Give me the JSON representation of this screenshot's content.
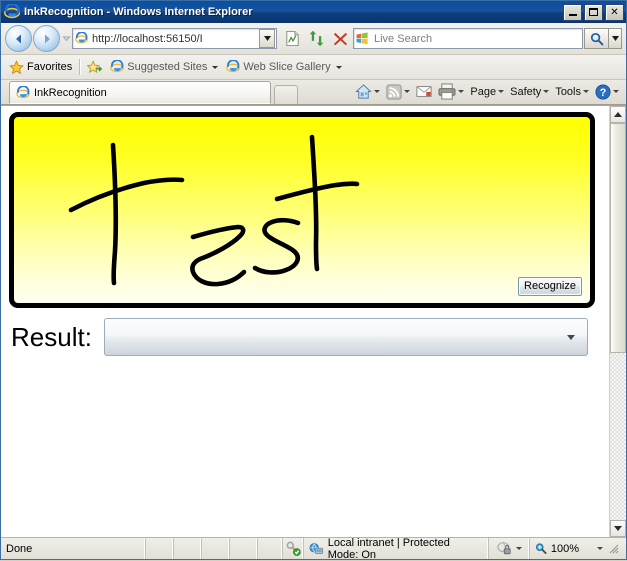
{
  "window": {
    "title": "InkRecognition - Windows Internet Explorer",
    "ie_icon": "ie-logo-icon",
    "controls": {
      "minimize": "minimize-button",
      "maximize": "maximize-button",
      "close_label": "✕"
    }
  },
  "navbar": {
    "back": "back-button",
    "forward": "forward-button",
    "history_dropdown": "history-dropdown-icon",
    "address": {
      "icon": "page-icon",
      "value": "http://localhost:56150/I",
      "dropdown_icon": "chevron-down-icon"
    },
    "buttons": {
      "compatibility": "compatibility-view-icon",
      "refresh": "refresh-icon",
      "stop": "stop-icon"
    },
    "search": {
      "icon": "windows-logo-icon",
      "placeholder": "Live Search",
      "go_icon": "search-icon",
      "provider_dropdown": "chevron-down-icon"
    }
  },
  "favorites_bar": {
    "favorites_label": "Favorites",
    "items": [
      {
        "label": "Suggested Sites",
        "icon": "ie-page-icon",
        "has_caret": true
      },
      {
        "label": "Web Slice Gallery",
        "icon": "ie-page-icon",
        "has_caret": true
      }
    ],
    "add_favorite_icon": "add-favorite-icon"
  },
  "tabs": [
    {
      "label": "InkRecognition",
      "icon": "ie-logo-icon",
      "active": true
    }
  ],
  "new_tab_label": "",
  "command_bar": [
    {
      "name": "home",
      "label": "",
      "icon": "home-icon",
      "caret": true
    },
    {
      "name": "feeds",
      "label": "",
      "icon": "rss-icon",
      "caret": true
    },
    {
      "name": "mail",
      "label": "",
      "icon": "mail-icon",
      "caret": false
    },
    {
      "name": "print",
      "label": "",
      "icon": "printer-icon",
      "caret": true
    },
    {
      "name": "page",
      "label": "Page",
      "icon": "",
      "caret": true
    },
    {
      "name": "safety",
      "label": "Safety",
      "icon": "",
      "caret": true
    },
    {
      "name": "tools",
      "label": "Tools",
      "icon": "",
      "caret": true
    },
    {
      "name": "help",
      "label": "",
      "icon": "help-icon",
      "caret": true
    }
  ],
  "page": {
    "ink_canvas": {
      "name": "ink-canvas",
      "handwritten_text": "test",
      "gradient_top_color": "#ffff00",
      "gradient_bottom_color": "#fffff2",
      "stroke_color": "#000000",
      "border_color": "#000000",
      "recognize_button_label": "Recognize"
    },
    "result": {
      "label": "Result:",
      "combo_value": "",
      "combo_dropdown_icon": "chevron-down-icon"
    }
  },
  "scrollbar": {
    "up_icon": "scroll-up-icon",
    "down_icon": "scroll-down-icon",
    "thumb": "scroll-thumb"
  },
  "status_bar": {
    "status_text": "Done",
    "security_icon": "security-key-icon",
    "zone_icon": "local-intranet-icon",
    "zone_text": "Local intranet | Protected Mode: On",
    "privacy_icon": "privacy-lock-icon",
    "zoom_icon": "zoom-magnifier-icon",
    "zoom_level": "100%",
    "resize_grip": "resize-grip"
  },
  "colors": {
    "titlebar": "#0a4fa0",
    "canvas_yellow": "#ffff00",
    "accent_blue": "#3a6ea5"
  }
}
